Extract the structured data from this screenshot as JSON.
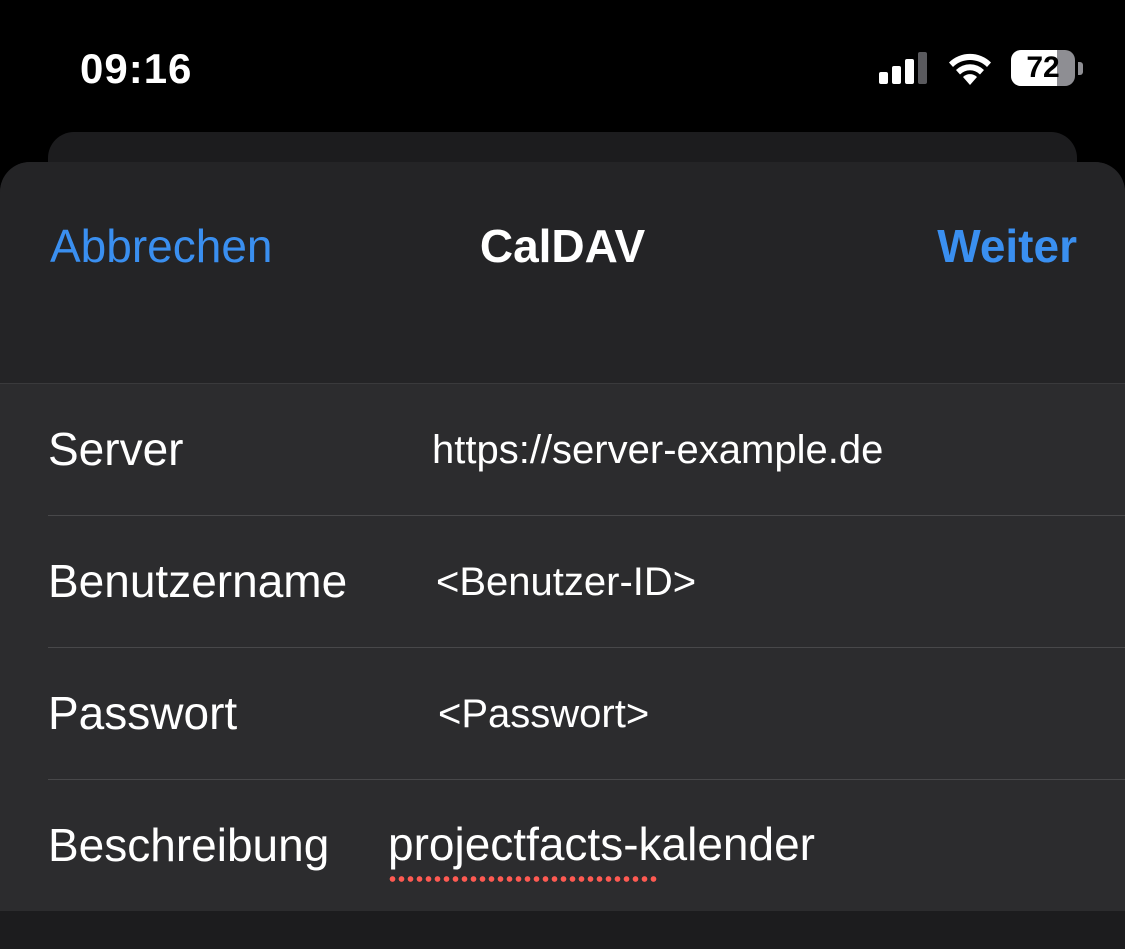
{
  "status_bar": {
    "time": "09:16",
    "battery_percent": "72",
    "battery_level": 0.72,
    "icons": [
      "signal-icon",
      "wifi-icon",
      "battery-icon"
    ]
  },
  "nav": {
    "cancel_label": "Abbrechen",
    "title": "CalDAV",
    "next_label": "Weiter"
  },
  "form": {
    "rows": [
      {
        "label": "Server",
        "value": "https://server-example.de"
      },
      {
        "label": "Benutzername",
        "value": "<Benutzer-ID>"
      },
      {
        "label": "Passwort",
        "value": "<Passwort>"
      },
      {
        "label": "Beschreibung",
        "value": "projectfacts-kalender"
      }
    ]
  },
  "colors": {
    "accent": "#3a8ff0",
    "background": "#000000",
    "sheet": "#1c1c1e",
    "row_background": "#2c2c2e",
    "spellcheck": "#ff5a52"
  }
}
